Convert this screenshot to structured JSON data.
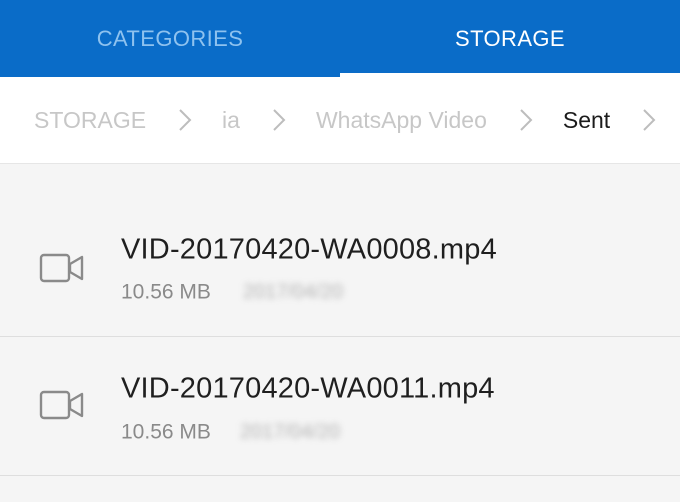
{
  "tabs": [
    {
      "label": "CATEGORIES",
      "active": false
    },
    {
      "label": "STORAGE",
      "active": true
    }
  ],
  "breadcrumb": [
    {
      "label": "STORAGE"
    },
    {
      "label": "ia"
    },
    {
      "label": "WhatsApp Video"
    },
    {
      "label": "Sent",
      "current": true
    }
  ],
  "files": [
    {
      "name": "VID-20170420-WA0008.mp4",
      "size": "10.56 MB",
      "date": "2017/04/20",
      "icon": "video-camera-icon"
    },
    {
      "name": "VID-20170420-WA0011.mp4",
      "size": "10.56 MB",
      "date": "2017/04/20",
      "icon": "video-camera-icon"
    }
  ],
  "colors": {
    "tabbar": "#0a6cc8",
    "tab_inactive": "#8ec2ef",
    "tab_active": "#ffffff"
  }
}
